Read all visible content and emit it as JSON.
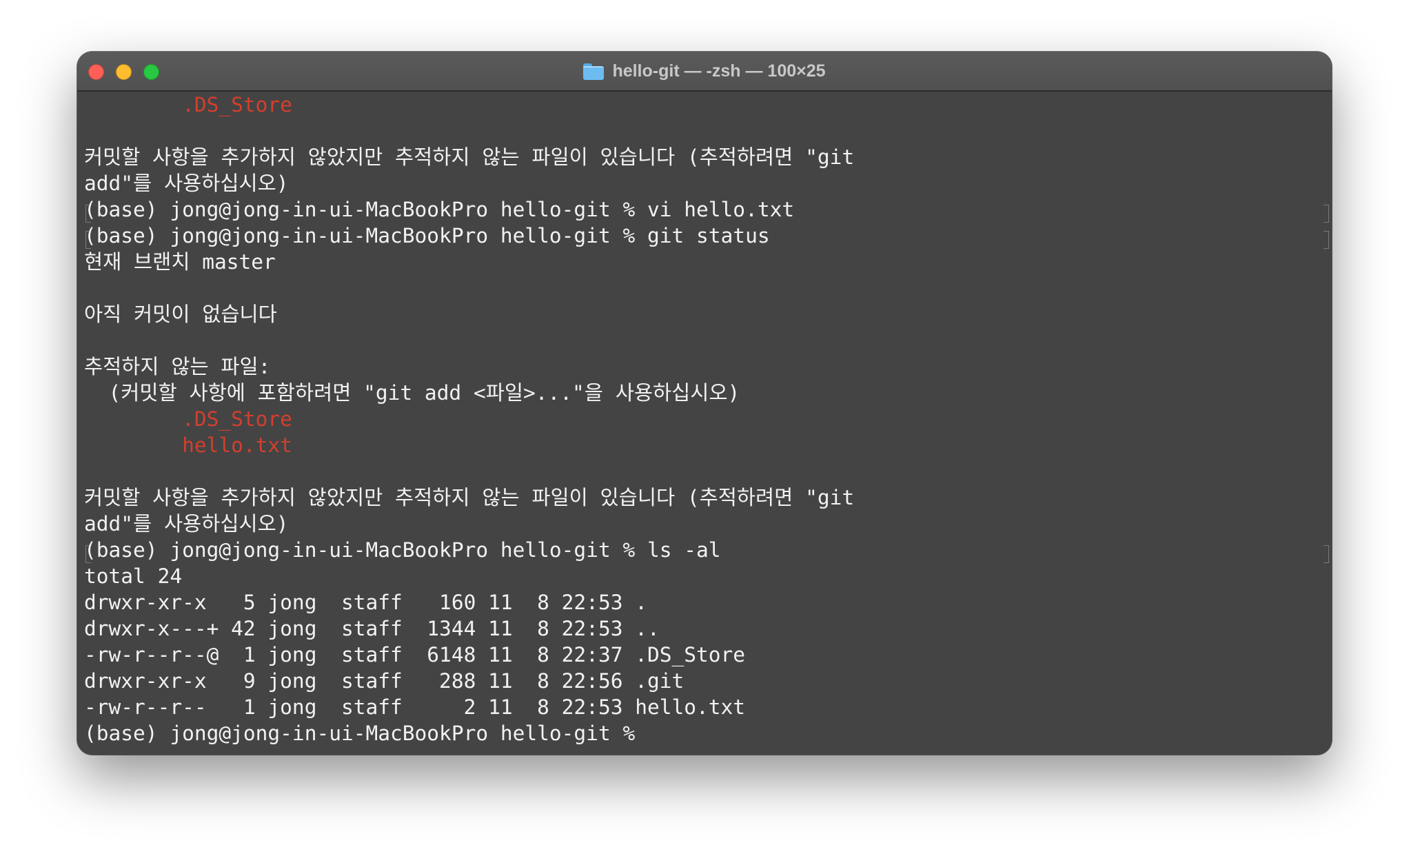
{
  "window": {
    "title": "hello-git — -zsh — 100×25"
  },
  "terminal": {
    "lines": [
      "        .DS_Store",
      "",
      "커밋할 사항을 추가하지 않았지만 추적하지 않는 파일이 있습니다 (추적하려면 \"git",
      "add\"를 사용하십시오)",
      "(base) jong@jong-in-ui-MacBookPro hello-git % vi hello.txt",
      "(base) jong@jong-in-ui-MacBookPro hello-git % git status",
      "현재 브랜치 master",
      "",
      "아직 커밋이 없습니다",
      "",
      "추적하지 않는 파일:",
      "  (커밋할 사항에 포함하려면 \"git add <파일>...\"을 사용하십시오)",
      "        .DS_Store",
      "        hello.txt",
      "",
      "커밋할 사항을 추가하지 않았지만 추적하지 않는 파일이 있습니다 (추적하려면 \"git",
      "add\"를 사용하십시오)",
      "(base) jong@jong-in-ui-MacBookPro hello-git % ls -al",
      "total 24",
      "drwxr-xr-x   5 jong  staff   160 11  8 22:53 .",
      "drwxr-x---+ 42 jong  staff  1344 11  8 22:53 ..",
      "-rw-r--r--@  1 jong  staff  6148 11  8 22:37 .DS_Store",
      "drwxr-xr-x   9 jong  staff   288 11  8 22:56 .git",
      "-rw-r--r--   1 jong  staff     2 11  8 22:53 hello.txt",
      "(base) jong@jong-in-ui-MacBookPro hello-git % "
    ]
  },
  "colors": {
    "window_background": "#444444",
    "text": "#f2f2f2",
    "untracked_file": "#d23f2e",
    "cursor": "#8e8e8e"
  },
  "icons": {
    "title": "folder-icon",
    "close": "close-button",
    "minimize": "minimize-button",
    "maximize": "maximize-button"
  }
}
